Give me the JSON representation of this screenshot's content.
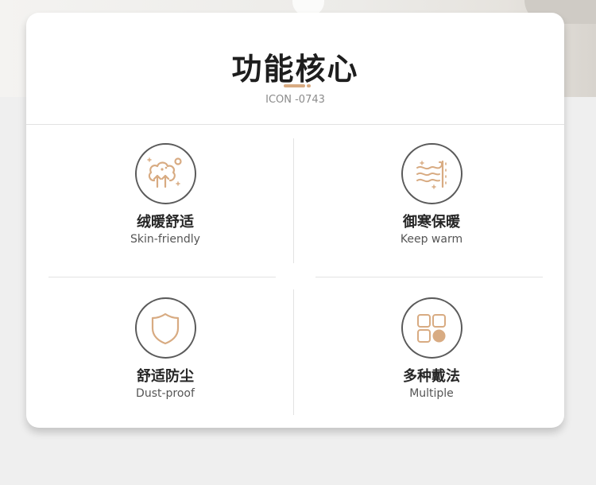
{
  "header": {
    "title": "功能核心",
    "subtitle": "ICON -0743"
  },
  "features": [
    {
      "title": "绒暖舒适",
      "subtitle": "Skin-friendly",
      "icon": "trees-icon"
    },
    {
      "title": "御寒保暖",
      "subtitle": "Keep warm",
      "icon": "wind-snow-icon"
    },
    {
      "title": "舒适防尘",
      "subtitle": "Dust-proof",
      "icon": "shield-icon"
    },
    {
      "title": "多种戴法",
      "subtitle": "Multiple",
      "icon": "grid-icon"
    }
  ],
  "colors": {
    "accent": "#d8ab82",
    "icon_ring": "#5a5a5a",
    "card": "#ffffff",
    "background": "#efefef"
  }
}
